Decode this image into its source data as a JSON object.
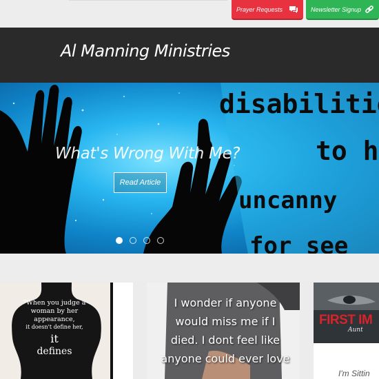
{
  "topbar": {
    "prayer_label": "Prayer Requests",
    "prayer_icon": "speech-bubbles-icon",
    "newsletter_label": "Newsletter Signup",
    "newsletter_icon": "link-icon",
    "colors": {
      "prayer": "#e8323f",
      "newsletter": "#2fb556"
    }
  },
  "header": {
    "site_title": "Al Manning Ministries"
  },
  "hero": {
    "image_text": [
      "disabilitie",
      "to h",
      "uncanny",
      "for see"
    ],
    "title": "What's Wrong With Me?",
    "button_label": "Read Article",
    "slide_count": 4,
    "active_slide": 1
  },
  "articles": [
    {
      "image_text": [
        "\"When you judge a",
        "woman by her",
        "appearance,",
        "it doesn't define her,",
        "it",
        "defines"
      ]
    },
    {
      "image_text": [
        "I wonder if anyone",
        "would miss me if I",
        "died. I dont feel like",
        "anyone could ever love"
      ]
    },
    {
      "image_text_main": "FIRST IM",
      "image_text_script": "Aunt",
      "excerpt": "I'm Sittin"
    }
  ]
}
